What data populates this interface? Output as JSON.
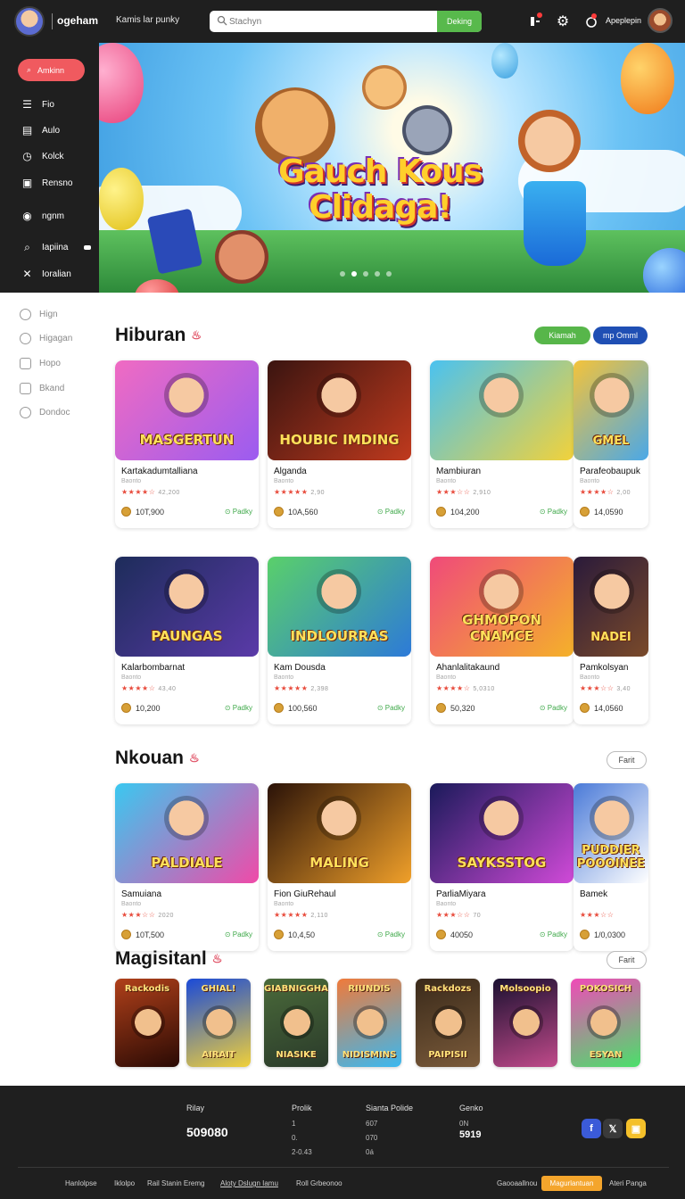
{
  "header": {
    "brand": "ogeham",
    "tagline": "Kamis lar punky",
    "search_placeholder": "Stachyn",
    "search_button": "Deking",
    "user_name": "Apeplepin"
  },
  "sidebar": {
    "cta_label": "Amkinn",
    "items": [
      {
        "icon": "list-icon",
        "label": "Fio"
      },
      {
        "icon": "clipboard-icon",
        "label": "Aulo"
      },
      {
        "icon": "clock-icon",
        "label": "Kolck"
      },
      {
        "icon": "bookmark-icon",
        "label": "Rensno"
      },
      {
        "icon": "circle-icon",
        "label": "ngnm"
      },
      {
        "icon": "search-icon",
        "label": "Iapiina"
      },
      {
        "icon": "close-icon",
        "label": "Ioralian"
      }
    ]
  },
  "subnav": {
    "items": [
      "Hign",
      "Higagan",
      "Hopo",
      "Bkand",
      "Dondoc"
    ]
  },
  "hero": {
    "title_line1": "Gauch Kous",
    "title_line2": "Clidaga!",
    "dots": 5,
    "active_dot": 2
  },
  "section1": {
    "title": "Hiburan",
    "chip_green": "Kiamah",
    "chip_blue": "mp Omml",
    "cards": [
      {
        "thumb": "MASGERTUN",
        "name": "Kartakadumtalliana",
        "sub": "Baonto",
        "rating": 4,
        "reviews": "42,200",
        "count": "10T,900",
        "play": "Padky",
        "colors": [
          "#f06bc2",
          "#9b5cf0"
        ]
      },
      {
        "thumb": "HOUBIC IMDING",
        "name": "Alganda",
        "sub": "Baonto",
        "rating": 5,
        "reviews": "2,90",
        "count": "10A,560",
        "play": "Padky",
        "colors": [
          "#3a1410",
          "#c03a1e"
        ]
      },
      {
        "thumb": "",
        "name": "Mambiuran",
        "sub": "Baonto",
        "rating": 3,
        "reviews": "2,910",
        "count": "104,200",
        "play": "Padky",
        "colors": [
          "#4ac2f0",
          "#f2d23a"
        ]
      },
      {
        "thumb": "GMEL",
        "name": "Parafeobaupuk",
        "sub": "Baonto",
        "rating": 4,
        "reviews": "2,00",
        "count": "14,0590",
        "play": "",
        "colors": [
          "#f4c33a",
          "#4aa8e8"
        ]
      }
    ]
  },
  "section1b": {
    "cards": [
      {
        "thumb": "PAUNGAS",
        "name": "Kalarbombarnat",
        "sub": "Baonto",
        "rating": 4,
        "reviews": "43,40",
        "count": "10,200",
        "play": "Padky",
        "colors": [
          "#1d2c5a",
          "#5a3aa8"
        ]
      },
      {
        "thumb": "INDLOURRAS",
        "name": "Kam Dousda",
        "sub": "Baonto",
        "rating": 5,
        "reviews": "2,398",
        "count": "100,560",
        "play": "Padky",
        "colors": [
          "#5ad06a",
          "#2d7ad8"
        ]
      },
      {
        "thumb": "GHMOPON CNAMCE",
        "name": "Ahanlalitakaund",
        "sub": "Baonto",
        "rating": 4,
        "reviews": "5,0310",
        "count": "50,320",
        "play": "Padky",
        "colors": [
          "#f04a7a",
          "#f4b12a"
        ]
      },
      {
        "thumb": "NADEI",
        "name": "Pamkolsyan",
        "sub": "Baonto",
        "rating": 3,
        "reviews": "3,40",
        "count": "14,0560",
        "play": "",
        "colors": [
          "#2a1a3a",
          "#7a4a2a"
        ]
      }
    ]
  },
  "section2": {
    "title": "Nkouan",
    "chip": "Farit",
    "cards": [
      {
        "thumb": "PALDIALE",
        "name": "Samuiana",
        "sub": "Baonto",
        "rating": 3,
        "reviews": "2020",
        "count": "10T,500",
        "play": "Padky",
        "colors": [
          "#3ac8f0",
          "#f04aa8"
        ]
      },
      {
        "thumb": "MALING",
        "name": "Fion GiuRehaul",
        "sub": "Baonto",
        "rating": 5,
        "reviews": "2,110",
        "count": "10,4,50",
        "play": "Padky",
        "colors": [
          "#2a1208",
          "#f0a02a"
        ]
      },
      {
        "thumb": "SAYKSSTOG",
        "name": "ParliaMiyara",
        "sub": "Baonto",
        "rating": 3,
        "reviews": "70",
        "count": "40050",
        "play": "Padky",
        "colors": [
          "#1a1a5a",
          "#d04ad8"
        ]
      },
      {
        "thumb": "PUDDIER POOOINEE",
        "name": "Bamek",
        "sub": "",
        "rating": 3,
        "reviews": "",
        "count": "1/0,0300",
        "play": "",
        "colors": [
          "#4a7ad8",
          "#ffffff"
        ]
      }
    ]
  },
  "section3": {
    "title": "Magisitanl",
    "chip": "Farit",
    "minis": [
      {
        "text": "Rackodis",
        "bottom": "",
        "colors": [
          "#b0401a",
          "#2a0a04"
        ]
      },
      {
        "text": "GHIAL!",
        "bottom": "AIRAIT",
        "colors": [
          "#1a4ad8",
          "#f0d03a"
        ]
      },
      {
        "text": "GIABNIGGHAS",
        "bottom": "NIASIKE",
        "colors": [
          "#4a6a3a",
          "#2a3a2a"
        ]
      },
      {
        "text": "RIUNDIS",
        "bottom": "NIDISMINS",
        "colors": [
          "#f07a3a",
          "#3ab8f0"
        ]
      },
      {
        "text": "Rackdozs",
        "bottom": "PAIPISII",
        "colors": [
          "#3a2a1a",
          "#7a5a3a"
        ]
      },
      {
        "text": "Molsoopio",
        "bottom": "",
        "colors": [
          "#1a1030",
          "#c04a8a"
        ]
      },
      {
        "text": "POKOSICH",
        "bottom": "ESYAN",
        "colors": [
          "#f04ab8",
          "#4ae06a"
        ]
      }
    ]
  },
  "footer": {
    "col1_head": "Rilay",
    "col1_big": "509080",
    "col2_head": "Prolik",
    "col2_lines": [
      "1",
      "0.",
      "2-0.43"
    ],
    "col3_head": "Sianta Polide",
    "col3_lines": [
      "607",
      "070",
      "0á"
    ],
    "col4_head": "Genko",
    "col4_lines": [
      "0N"
    ],
    "col4_big": "5919",
    "links": [
      "Hanlolpse",
      "Iklolpo",
      "Rail Stanin Eremg",
      "Aloty Dslugn Iamu",
      "Roll Grbeonoo"
    ],
    "right_link1": "Gaooaallnou",
    "cta": "Magurlantuan",
    "right_link2": "Ateri Panga",
    "social_colors": [
      "#3b5bd8",
      "#3a3a3a",
      "#f4c02a"
    ]
  }
}
